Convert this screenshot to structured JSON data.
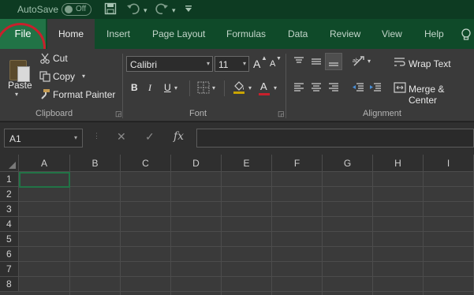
{
  "titlebar": {
    "autosave_label": "AutoSave",
    "toggle_state": "Off",
    "icons": [
      "save-icon",
      "undo-icon",
      "redo-icon",
      "customize-icon"
    ]
  },
  "tabs": [
    {
      "label": "File"
    },
    {
      "label": "Home"
    },
    {
      "label": "Insert"
    },
    {
      "label": "Page Layout"
    },
    {
      "label": "Formulas"
    },
    {
      "label": "Data"
    },
    {
      "label": "Review"
    },
    {
      "label": "View"
    },
    {
      "label": "Help"
    }
  ],
  "clipboard": {
    "paste_label": "Paste",
    "cut_label": "Cut",
    "copy_label": "Copy",
    "format_painter_label": "Format Painter",
    "group_label": "Clipboard"
  },
  "font": {
    "font_name": "Calibri",
    "font_size": "11",
    "bold": "B",
    "italic": "I",
    "underline": "U",
    "grow_label": "A",
    "shrink_label": "A",
    "font_color_label": "A",
    "group_label": "Font"
  },
  "alignment": {
    "wrap_text_label": "Wrap Text",
    "merge_center_label": "Merge & Center",
    "group_label": "Alignment"
  },
  "formula_bar": {
    "name_box": "A1",
    "fx_label": "fx",
    "formula_value": ""
  },
  "grid": {
    "columns": [
      "A",
      "B",
      "C",
      "D",
      "E",
      "F",
      "G",
      "H",
      "I"
    ],
    "rows": [
      "1",
      "2",
      "3",
      "4",
      "5",
      "6",
      "7",
      "8"
    ]
  },
  "colors": {
    "excel_green": "#217346",
    "highlight_circle": "#c8202c"
  }
}
